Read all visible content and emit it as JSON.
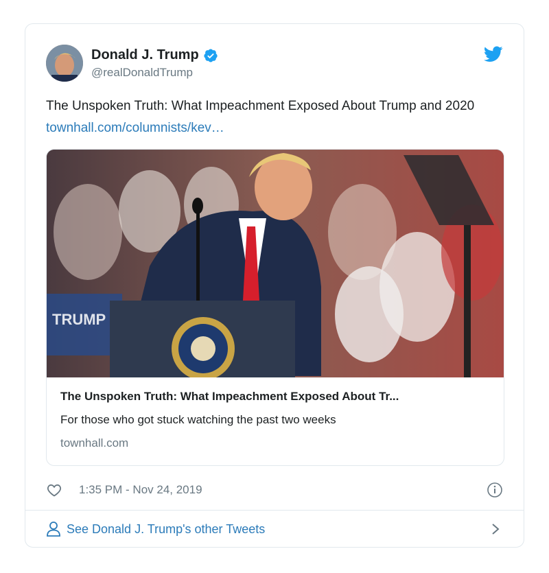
{
  "author": {
    "name": "Donald J. Trump",
    "handle": "@realDonaldTrump",
    "verified": true
  },
  "tweet": {
    "text": "The Unspoken Truth: What Impeachment Exposed About Trump and 2020 ",
    "link": "townhall.com/columnists/kev…"
  },
  "card": {
    "title": "The Unspoken Truth: What Impeachment Exposed About Tr...",
    "description": "For those who got stuck watching the past two weeks",
    "domain": "townhall.com",
    "image_icon": "rally-photo"
  },
  "meta": {
    "timestamp": "1:35 PM - Nov 24, 2019"
  },
  "footer": {
    "see_more": "See Donald J. Trump's other Tweets"
  },
  "colors": {
    "accent": "#1da1f2",
    "link": "#2b7bb9",
    "muted": "#697882",
    "border": "#e1e8ed"
  }
}
